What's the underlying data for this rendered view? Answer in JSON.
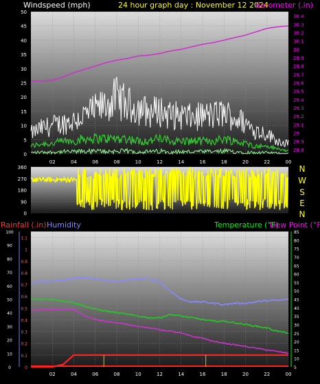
{
  "header": {
    "title": "24 hour graph day : November 12 2024",
    "left_label": "Windspeed (mph)",
    "right_label": "Barometer (.in)"
  },
  "wind_dir_header": {
    "compass": [
      "N",
      "W",
      "S",
      "E",
      "N"
    ]
  },
  "bottom_header": {
    "rainfall_label": "Rainfall (.in)",
    "humidity_label": "Humidity",
    "temperature_label": "Temperature (°F)",
    "dewpoint_label": "Dew Point (°F)"
  },
  "colors": {
    "wind_max": "#ffffff",
    "wind_avg": "#33cc33",
    "wind_band": "#99ff99",
    "barometer": "#cc33cc",
    "direction": "#ffff00",
    "rain": "#ff2222",
    "rain_marks": "#cccc00",
    "humidity": "#8888ff",
    "temperature": "#22cc22",
    "dewpoint": "#cc33cc",
    "rain_axis": "#ff3333",
    "humidity_axis": "#7777ff",
    "temp_axis": "#00ff00"
  },
  "chart_data": [
    {
      "type": "line",
      "title": "24 hour graph day : November 12 2024",
      "x_ticks": [
        "02",
        "04",
        "06",
        "08",
        "10",
        "12",
        "14",
        "16",
        "18",
        "20",
        "22",
        "00"
      ],
      "y_left": {
        "label": "Windspeed (mph)",
        "ticks": [
          "0",
          "5",
          "10",
          "15",
          "20",
          "25",
          "30",
          "35",
          "40",
          "45",
          "50"
        ],
        "range": [
          0,
          50
        ]
      },
      "y_right": {
        "label": "Barometer (.in)",
        "ticks": [
          "28.8",
          "28.9",
          "29",
          "29.1",
          "29.2",
          "29.3",
          "29.4",
          "29.5",
          "29.6",
          "29.7",
          "29.8",
          "29.9",
          "30",
          "30.1",
          "30.2",
          "30.3",
          "30.4"
        ],
        "range": [
          28.75,
          30.45
        ]
      },
      "series": [
        {
          "name": "Barometer (.in)",
          "x": [
            0,
            1,
            2,
            3,
            4,
            5,
            6,
            7,
            8,
            9,
            10,
            11,
            12,
            13,
            14,
            15,
            16,
            17,
            18,
            19,
            20,
            21,
            22,
            23,
            24
          ],
          "values": [
            29.62,
            29.62,
            29.63,
            29.67,
            29.72,
            29.76,
            29.8,
            29.84,
            29.87,
            29.89,
            29.92,
            29.93,
            29.95,
            29.98,
            30.0,
            30.03,
            30.06,
            30.08,
            30.11,
            30.14,
            30.17,
            30.21,
            30.25,
            30.27,
            30.28
          ]
        },
        {
          "name": "Wind gust",
          "x": [
            0,
            1,
            2,
            3,
            4,
            5,
            6,
            7,
            8,
            9,
            10,
            11,
            12,
            13,
            14,
            15,
            16,
            17,
            18,
            19,
            20,
            21,
            22,
            23,
            24
          ],
          "values": [
            8,
            10,
            11,
            12,
            13,
            15,
            17,
            19,
            22,
            19,
            18,
            16,
            17,
            15,
            15,
            14,
            15,
            15,
            16,
            14,
            12,
            9,
            8,
            5,
            4
          ]
        },
        {
          "name": "Wind speed",
          "x": [
            0,
            1,
            2,
            3,
            4,
            5,
            6,
            7,
            8,
            9,
            10,
            11,
            12,
            13,
            14,
            15,
            16,
            17,
            18,
            19,
            20,
            21,
            22,
            23,
            24
          ],
          "values": [
            3,
            4,
            4,
            5,
            5,
            6,
            6,
            6,
            6,
            6,
            5,
            5,
            6,
            5,
            5,
            5,
            5,
            5,
            6,
            5,
            4,
            3,
            3,
            2,
            1
          ]
        }
      ]
    },
    {
      "type": "line",
      "title": "",
      "y_left": {
        "ticks": [
          "0",
          "90",
          "180",
          "270",
          "360"
        ],
        "range": [
          0,
          360
        ]
      },
      "compass": [
        "N",
        "W",
        "S",
        "E",
        "N"
      ],
      "series": [
        {
          "name": "Wind direction",
          "x": [
            0,
            1,
            2,
            3,
            4,
            5,
            6,
            7,
            8,
            9,
            10,
            11,
            12,
            13,
            14,
            15,
            16,
            17,
            18,
            19,
            20,
            21,
            22,
            23,
            24
          ],
          "values": [
            250,
            260,
            255,
            270,
            90,
            300,
            60,
            280,
            80,
            260,
            70,
            290,
            100,
            270,
            60,
            280,
            90,
            300,
            70,
            260,
            80,
            270,
            90,
            290,
            300
          ]
        }
      ]
    },
    {
      "type": "line",
      "title": "",
      "x_ticks": [
        "02",
        "04",
        "06",
        "08",
        "10",
        "12",
        "14",
        "16",
        "18",
        "20",
        "22",
        "00"
      ],
      "y_rain": {
        "label": "Rainfall (.in)",
        "ticks": [
          "0",
          "0.1",
          "0.2",
          "0.3",
          "0.4",
          "0.5",
          "0.6",
          "0.7",
          "0.8",
          "0.9",
          "1",
          "1.1"
        ],
        "range": [
          0,
          1.15
        ]
      },
      "y_humidity": {
        "label": "Humidity",
        "ticks": [
          "0",
          "10",
          "20",
          "30",
          "40",
          "50",
          "60",
          "70",
          "80",
          "90",
          "100"
        ],
        "range": [
          0,
          100
        ]
      },
      "y_temp": {
        "label": "Temperature (°F)",
        "ticks": [
          "5",
          "10",
          "15",
          "20",
          "25",
          "30",
          "35",
          "40",
          "45",
          "50",
          "55",
          "60",
          "65",
          "70",
          "75",
          "80",
          "85"
        ],
        "range": [
          5,
          85
        ]
      },
      "series": [
        {
          "name": "Humidity",
          "x": [
            0,
            1,
            2,
            3,
            4,
            5,
            6,
            7,
            8,
            9,
            10,
            11,
            12,
            13,
            14,
            15,
            16,
            17,
            18,
            19,
            20,
            21,
            22,
            23,
            24
          ],
          "values": [
            62,
            63,
            63,
            64,
            65,
            66,
            65,
            64,
            63,
            64,
            65,
            65,
            63,
            56,
            50,
            48,
            48,
            47,
            46,
            47,
            47,
            48,
            49,
            49,
            50
          ]
        },
        {
          "name": "Temperature (°F)",
          "x": [
            0,
            1,
            2,
            3,
            4,
            5,
            6,
            7,
            8,
            9,
            10,
            11,
            12,
            13,
            14,
            15,
            16,
            17,
            18,
            19,
            20,
            21,
            22,
            23,
            24
          ],
          "values": [
            45,
            45,
            45,
            44,
            43,
            41,
            39,
            38,
            37,
            36,
            35,
            34,
            34,
            36,
            35,
            34,
            33,
            32,
            32,
            31,
            30,
            29,
            28,
            26,
            25
          ]
        },
        {
          "name": "Dew Point (°F)",
          "x": [
            0,
            1,
            2,
            3,
            4,
            5,
            6,
            7,
            8,
            9,
            10,
            11,
            12,
            13,
            14,
            15,
            16,
            17,
            18,
            19,
            20,
            21,
            22,
            23,
            24
          ],
          "values": [
            38,
            39,
            39,
            39,
            39,
            35,
            33,
            32,
            31,
            30,
            29,
            28,
            27,
            26,
            25,
            23,
            22,
            20,
            19,
            18,
            17,
            16,
            15,
            14,
            13
          ]
        },
        {
          "name": "Rainfall (.in)",
          "x": [
            0,
            1,
            2,
            3,
            4,
            5,
            6,
            7,
            8,
            9,
            10,
            11,
            12,
            13,
            14,
            15,
            16,
            17,
            18,
            19,
            20,
            21,
            22,
            23,
            24
          ],
          "values": [
            0,
            0,
            0,
            0.02,
            0.1,
            0.1,
            0.1,
            0.1,
            0.1,
            0.1,
            0.1,
            0.1,
            0.1,
            0.1,
            0.1,
            0.1,
            0.1,
            0.1,
            0.1,
            0.1,
            0.1,
            0.1,
            0.1,
            0.1,
            0.1
          ]
        }
      ]
    }
  ]
}
